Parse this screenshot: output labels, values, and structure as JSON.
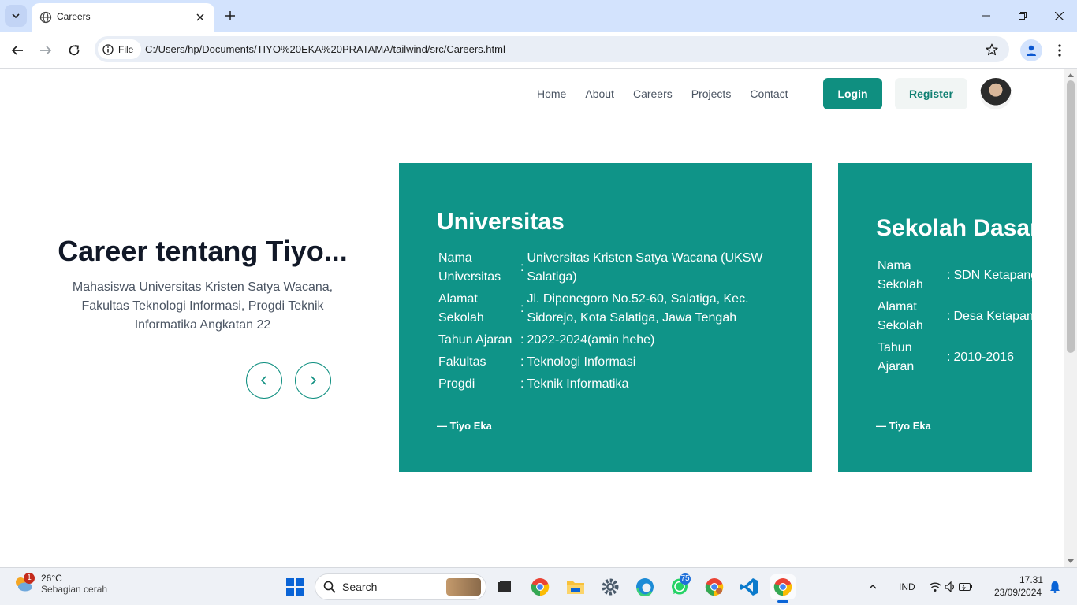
{
  "browser": {
    "tab_title": "Careers",
    "site_label": "File",
    "url": "C:/Users/hp/Documents/TIYO%20EKA%20PRATAMA/tailwind/src/Careers.html"
  },
  "nav": {
    "links": [
      "Home",
      "About",
      "Careers",
      "Projects",
      "Contact"
    ],
    "login": "Login",
    "register": "Register"
  },
  "hero": {
    "title": "Career tentang Tiyo...",
    "subtitle": "Mahasiswa Universitas Kristen Satya Wacana, Fakultas Teknologi Informasi, Progdi Teknik Informatika Angkatan 22"
  },
  "cards": [
    {
      "title": "Universitas",
      "rows": [
        {
          "label": "Nama Universitas",
          "sep": ":",
          "value": "Universitas Kristen Satya Wacana (UKSW Salatiga)"
        },
        {
          "label": "Alamat Sekolah",
          "sep": ":",
          "value": "Jl. Diponegoro No.52-60, Salatiga, Kec. Sidorejo, Kota Salatiga, Jawa Tengah"
        },
        {
          "label": "Tahun Ajaran",
          "sep": ":",
          "value": "2022-2024(amin hehe)"
        },
        {
          "label": "Fakultas",
          "sep": ":",
          "value": "Teknologi Informasi"
        },
        {
          "label": "Progdi",
          "sep": ":",
          "value": "Teknik Informatika"
        }
      ],
      "author": "— Tiyo Eka"
    },
    {
      "title": "Sekolah Dasar",
      "rows": [
        {
          "label": "Nama Sekolah",
          "sep": ":",
          "value": "SDN Ketapang"
        },
        {
          "label": "Alamat Sekolah",
          "sep": ":",
          "value": "Desa Ketapang, Kab.Semarang"
        },
        {
          "label": "Tahun Ajaran",
          "sep": ":",
          "value": "2010-2016"
        }
      ],
      "author": "— Tiyo Eka"
    }
  ],
  "taskbar": {
    "weather_temp": "26°C",
    "weather_desc": "Sebagian cerah",
    "weather_badge": "1",
    "search_placeholder": "Search",
    "whatsapp_badge": "75",
    "language": "IND",
    "time": "17.31",
    "date": "23/09/2024"
  },
  "colors": {
    "accent": "#0f9488",
    "tabbar": "#d3e3fd"
  }
}
